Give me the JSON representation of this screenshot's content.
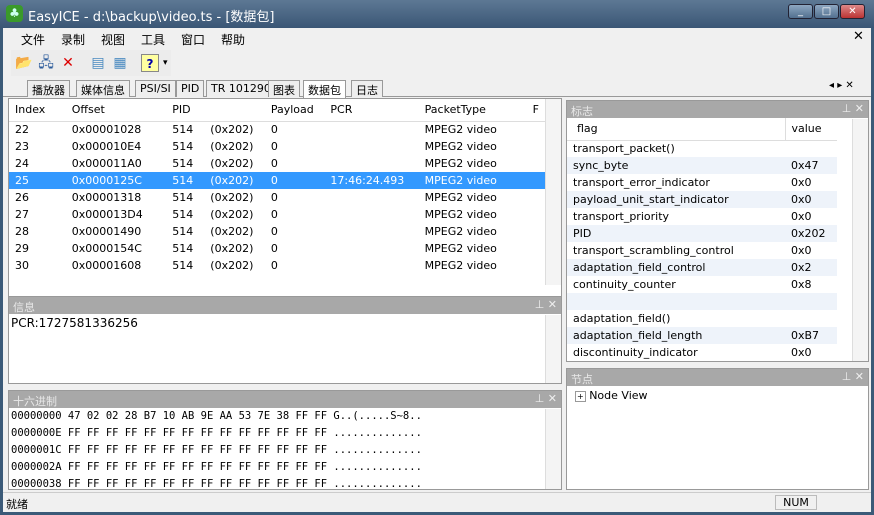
{
  "window": {
    "title": "EasyICE - d:\\backup\\video.ts - [数据包]"
  },
  "menu": [
    "文件",
    "录制",
    "视图",
    "工具",
    "窗口",
    "帮助"
  ],
  "toolbar": [
    {
      "icon": "open-folder-icon",
      "glyph": "📂"
    },
    {
      "icon": "network-icon",
      "glyph": "🖧"
    },
    {
      "icon": "close-x-icon",
      "glyph": "✕"
    },
    {
      "icon": "notepad-icon",
      "glyph": "▤"
    },
    {
      "icon": "calculator-icon",
      "glyph": "▦"
    },
    {
      "icon": "help-icon",
      "glyph": "?"
    }
  ],
  "tabs": [
    "播放器",
    "媒体信息",
    "PSI/SI",
    "PID",
    "TR 101290",
    "图表",
    "数据包",
    "日志"
  ],
  "active_tab": 6,
  "packets": {
    "columns": [
      "Index",
      "Offset",
      "PID",
      "Payload",
      "PCR",
      "PacketType",
      "F"
    ],
    "rows": [
      [
        "22",
        "0x00001028",
        "514",
        "(0x202)",
        "0",
        "",
        "MPEG2 video"
      ],
      [
        "23",
        "0x000010E4",
        "514",
        "(0x202)",
        "0",
        "",
        "MPEG2 video"
      ],
      [
        "24",
        "0x000011A0",
        "514",
        "(0x202)",
        "0",
        "",
        "MPEG2 video"
      ],
      [
        "25",
        "0x0000125C",
        "514",
        "(0x202)",
        "0",
        "17:46:24.493",
        "MPEG2 video"
      ],
      [
        "26",
        "0x00001318",
        "514",
        "(0x202)",
        "0",
        "",
        "MPEG2 video"
      ],
      [
        "27",
        "0x000013D4",
        "514",
        "(0x202)",
        "0",
        "",
        "MPEG2 video"
      ],
      [
        "28",
        "0x00001490",
        "514",
        "(0x202)",
        "0",
        "",
        "MPEG2 video"
      ],
      [
        "29",
        "0x0000154C",
        "514",
        "(0x202)",
        "0",
        "",
        "MPEG2 video"
      ],
      [
        "30",
        "0x00001608",
        "514",
        "(0x202)",
        "0",
        "",
        "MPEG2 video"
      ]
    ],
    "selected": 3
  },
  "info": {
    "title": "信息",
    "text": "PCR:1727581336256"
  },
  "hex": {
    "title": "十六进制",
    "lines": [
      "00000000 47 02 02 28 B7 10 AB 9E AA 53 7E 38 FF FF G..(.....S~8..",
      "0000000E FF FF FF FF FF FF FF FF FF FF FF FF FF FF ..............",
      "0000001C FF FF FF FF FF FF FF FF FF FF FF FF FF FF ..............",
      "0000002A FF FF FF FF FF FF FF FF FF FF FF FF FF FF ..............",
      "00000038 FF FF FF FF FF FF FF FF FF FF FF FF FF FF .............."
    ]
  },
  "flags": {
    "title": "标志",
    "columns": [
      "flag",
      "value"
    ],
    "rows": [
      [
        "transport_packet()",
        ""
      ],
      [
        "sync_byte",
        "0x47"
      ],
      [
        "transport_error_indicator",
        "0x0"
      ],
      [
        "payload_unit_start_indicator",
        "0x0"
      ],
      [
        "transport_priority",
        "0x0"
      ],
      [
        "PID",
        "0x202"
      ],
      [
        "transport_scrambling_control",
        "0x0"
      ],
      [
        "adaptation_field_control",
        "0x2"
      ],
      [
        "continuity_counter",
        "0x8"
      ],
      [
        "",
        ""
      ],
      [
        "adaptation_field()",
        ""
      ],
      [
        "adaptation_field_length",
        "0xB7"
      ],
      [
        "discontinuity_indicator",
        "0x0"
      ]
    ]
  },
  "nodes": {
    "title": "节点",
    "root": "Node View"
  },
  "status": {
    "text": "就绪",
    "num": "NUM"
  }
}
